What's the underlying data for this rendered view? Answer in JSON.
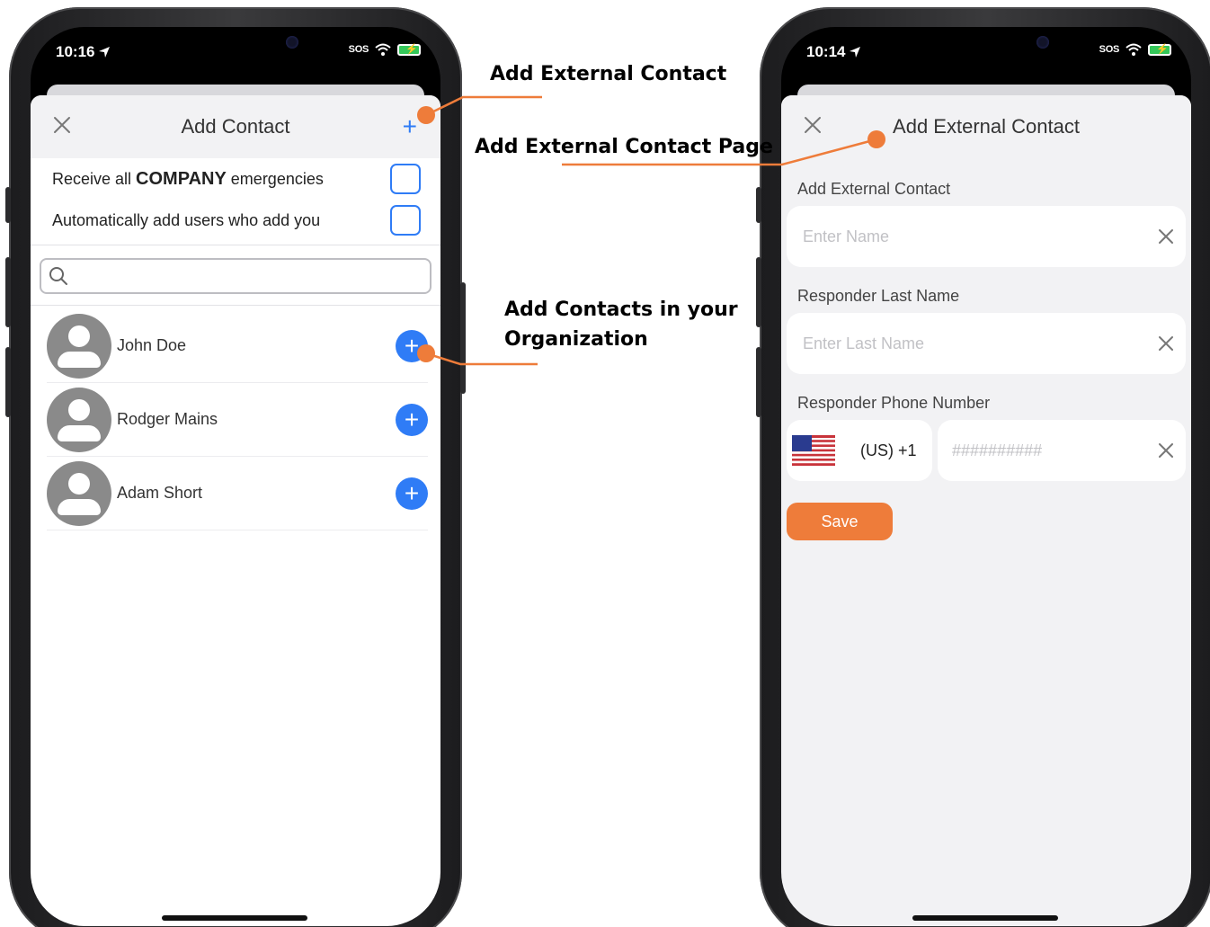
{
  "annotations": {
    "add_external_contact": "Add External Contact",
    "add_external_contact_page": "Add External Contact Page",
    "add_contacts_org_line1": "Add Contacts in your",
    "add_contacts_org_line2": "Organization"
  },
  "left_phone": {
    "status": {
      "time": "10:16",
      "sos": "SOS"
    },
    "header": {
      "title": "Add Contact"
    },
    "options": [
      {
        "prefix": "Receive all ",
        "strong": "COMPANY",
        "suffix": " emergencies",
        "checked": false
      },
      {
        "label": "Automatically add users who add you",
        "checked": false
      }
    ],
    "search": {
      "placeholder": ""
    },
    "contacts": [
      {
        "name": "John Doe"
      },
      {
        "name": "Rodger Mains"
      },
      {
        "name": "Adam Short"
      }
    ]
  },
  "right_phone": {
    "status": {
      "time": "10:14",
      "sos": "SOS"
    },
    "header": {
      "title": "Add External Contact"
    },
    "fields": {
      "first_name": {
        "label": "Add External Contact",
        "placeholder": "Enter Name"
      },
      "last_name": {
        "label": "Responder Last Name",
        "placeholder": "Enter Last Name"
      },
      "phone": {
        "label": "Responder Phone Number",
        "country_code": "(US) +1",
        "placeholder": "##########"
      }
    },
    "save_label": "Save"
  },
  "colors": {
    "accent_blue": "#2f7cf6",
    "accent_orange": "#ee7c3a"
  }
}
